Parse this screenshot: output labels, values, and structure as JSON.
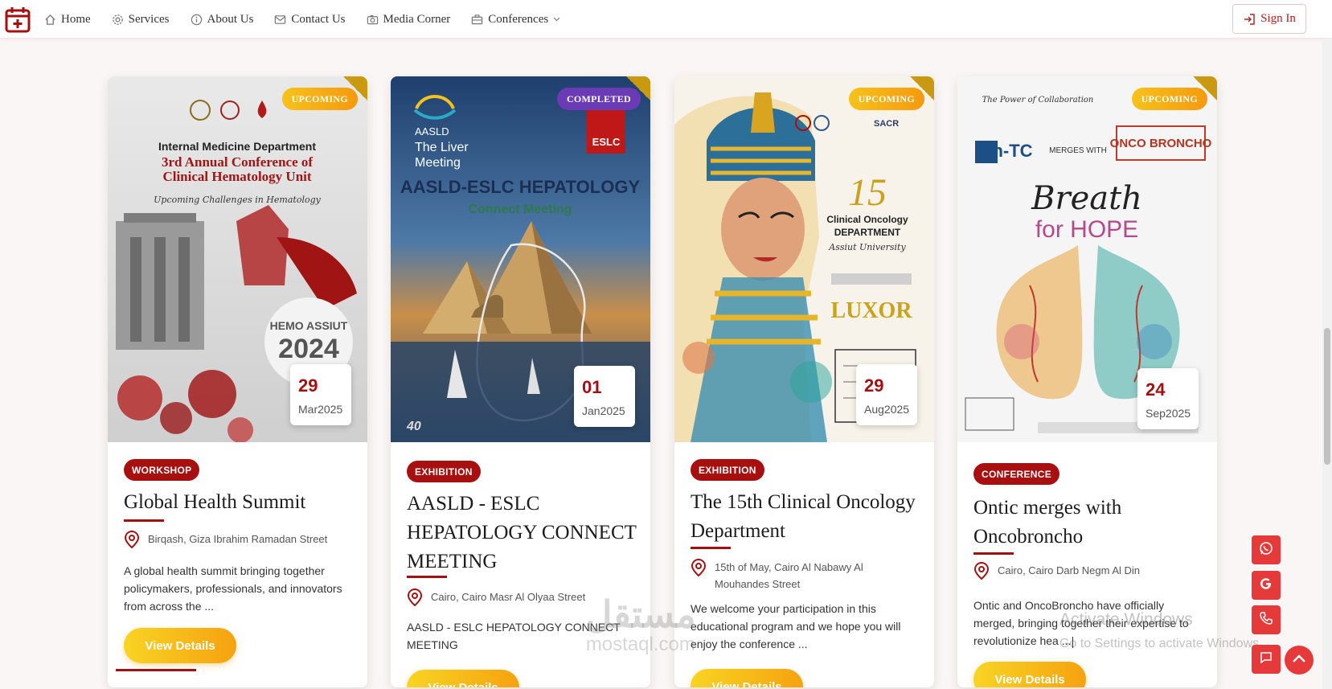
{
  "nav": {
    "items": [
      {
        "label": "Home",
        "icon": "home-icon"
      },
      {
        "label": "Services",
        "icon": "gear-icon"
      },
      {
        "label": "About Us",
        "icon": "info-icon"
      },
      {
        "label": "Contact Us",
        "icon": "mail-icon"
      },
      {
        "label": "Media Corner",
        "icon": "camera-icon"
      },
      {
        "label": "Conferences",
        "icon": "briefcase-icon"
      }
    ],
    "signin": "Sign In"
  },
  "colors": {
    "brand": "#a50f0f",
    "accent": "#f6a20f",
    "completed": "#6a3bb5",
    "fab": "#e63939"
  },
  "cards": [
    {
      "status": "UPCOMING",
      "day": "29",
      "month_year": "Mar2025",
      "badge": "WORKSHOP",
      "title": "Global Health Summit",
      "location": "Birqash, Giza Ibrahim Ramadan Street",
      "description": "A global health summit bringing together policymakers, professionals, and innovators from across the ...",
      "button": "View Details",
      "poster": {
        "l1": "Internal Medicine Department",
        "l2": "3rd Annual Conference of",
        "l3": "Clinical Hematology Unit",
        "l4": "Upcoming Challenges in Hematology",
        "l5": "HEMO ASSIUT",
        "l6": "2024"
      }
    },
    {
      "status": "COMPLETED",
      "day": "01",
      "month_year": "Jan2025",
      "badge": "EXHIBITION",
      "title": "AASLD - ESLC HEPATOLOGY CONNECT MEETING",
      "location": "Cairo, Cairo Masr Al Olyaa Street",
      "description": "AASLD - ESLC HEPATOLOGY CONNECT MEETING",
      "button": "View Details",
      "poster": {
        "l1": "AASLD",
        "l2": "The Liver",
        "l3": "Meeting",
        "l4": "ESLC",
        "l5": "AASLD-ESLC HEPATOLOGY",
        "l6": "Connect Meeting"
      }
    },
    {
      "status": "UPCOMING",
      "day": "29",
      "month_year": "Aug2025",
      "badge": "EXHIBITION",
      "title": "The 15th Clinical Oncology Department",
      "location": "15th of May, Cairo Al Nabawy Al Mouhandes Street",
      "description": "We welcome your participation in this educational program and we hope you will enjoy the conference ...",
      "button": "View Details",
      "poster": {
        "l1": "15",
        "l2": "Clinical Oncology",
        "l3": "DEPARTMENT",
        "l4": "Assiut University",
        "l5": "LUXOR",
        "l6": "SACR"
      }
    },
    {
      "status": "UPCOMING",
      "day": "24",
      "month_year": "Sep2025",
      "badge": "CONFERENCE",
      "title": "Ontic merges with Oncobroncho",
      "location": "Cairo, Cairo Darb Negm Al Din",
      "description": "Ontic and OncoBroncho have officially merged, bringing together their expertise to revolutionize hea ...",
      "button": "View Details",
      "poster": {
        "l1": "The Power of Collaboration",
        "l2": "on-TC",
        "l3": "MERGES WITH",
        "l4": "ONCO BRONCHO",
        "l5": "Breath",
        "l6": "for HOPE"
      }
    }
  ],
  "floating": [
    "whatsapp-icon",
    "google-icon",
    "phone-icon",
    "chat-icon"
  ],
  "watermark": {
    "line1": "Activate Windows",
    "line2": "Go to Settings to activate Windows."
  },
  "mostaql": {
    "line1": "مستقل",
    "line2": "mostaql.com"
  }
}
